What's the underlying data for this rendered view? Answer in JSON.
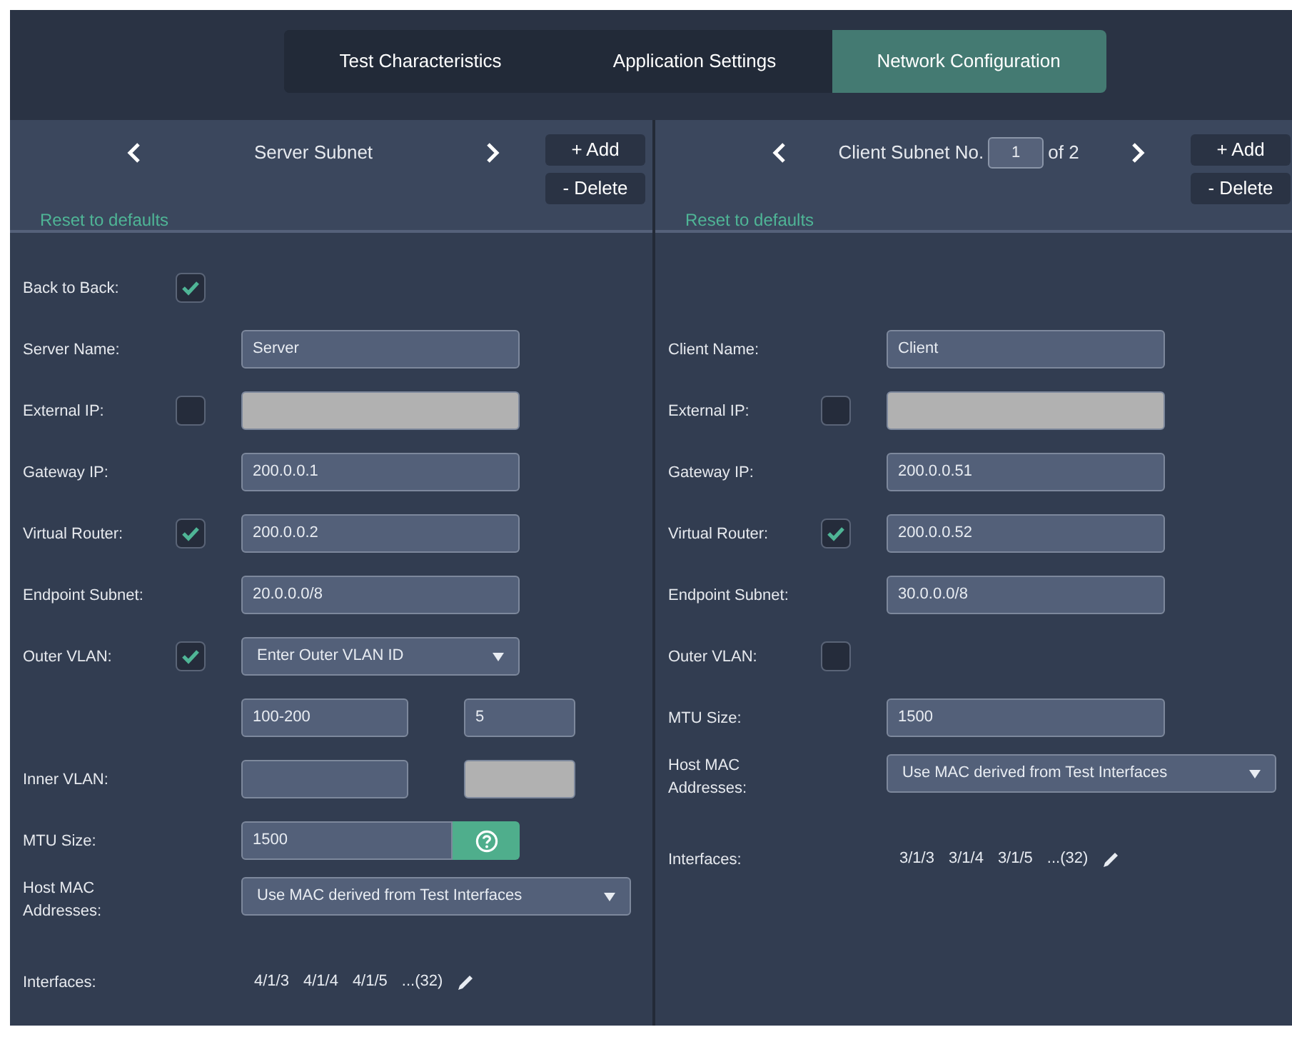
{
  "tabs": [
    {
      "label": "Test Characteristics",
      "selected": false
    },
    {
      "label": "Application Settings",
      "selected": false
    },
    {
      "label": "Network Configuration",
      "selected": true
    }
  ],
  "panels": [
    {
      "header": {
        "kind": "title",
        "title": "Server Subnet",
        "add": "+ Add",
        "delete": "- Delete",
        "reset": "Reset to defaults"
      },
      "rows": [
        {
          "kind": "check",
          "label": "Back to Back:",
          "checked": true
        },
        {
          "kind": "input",
          "label": "Server Name:",
          "value": "Server",
          "disabled": false
        },
        {
          "kind": "input",
          "label": "External IP:",
          "checked": false,
          "disabled": true
        },
        {
          "kind": "input",
          "label": "Gateway IP:",
          "value": "200.0.0.1",
          "disabled": false
        },
        {
          "kind": "input",
          "label": "Virtual Router:",
          "checked": true,
          "value": "200.0.0.2",
          "disabled": false
        },
        {
          "kind": "input",
          "label": "Endpoint Subnet:",
          "value": "20.0.0.0/8",
          "disabled": false
        },
        {
          "kind": "select",
          "label": "Outer VLAN:",
          "checked": true,
          "value": "Enter Outer VLAN ID"
        },
        {
          "kind": "pair",
          "fields": [
            {
              "value": "100-200",
              "disabled": false
            },
            {
              "value": "5",
              "disabled": false
            }
          ]
        },
        {
          "kind": "pair",
          "label": "Inner VLAN:",
          "fields": [
            {
              "disabled": false
            },
            {
              "disabled": true
            }
          ]
        },
        {
          "kind": "help_input",
          "label": "MTU Size:",
          "value": "1500"
        },
        {
          "kind": "wide_select",
          "label": "Host MAC Addresses:",
          "value": "Use MAC derived from Test Interfaces"
        },
        {
          "kind": "interfaces",
          "label": "Interfaces:",
          "items": [
            "4/1/3",
            "4/1/4",
            "4/1/5",
            "...(32)"
          ]
        }
      ]
    },
    {
      "header": {
        "kind": "counter",
        "title": "Client Subnet No.",
        "number": "1",
        "of": "of 2",
        "add": "+ Add",
        "delete": "- Delete",
        "reset": "Reset to defaults"
      },
      "rows": [
        {
          "kind": "input",
          "label": "Client Name:",
          "value": "Client",
          "disabled": false
        },
        {
          "kind": "input",
          "label": "External IP:",
          "checked": false,
          "disabled": true
        },
        {
          "kind": "input",
          "label": "Gateway IP:",
          "value": "200.0.0.51",
          "disabled": false
        },
        {
          "kind": "input",
          "label": "Virtual Router:",
          "checked": true,
          "value": "200.0.0.52",
          "disabled": false
        },
        {
          "kind": "input",
          "label": "Endpoint Subnet:",
          "value": "30.0.0.0/8",
          "disabled": false
        },
        {
          "kind": "check",
          "label": "Outer VLAN:",
          "checked": false
        },
        {
          "kind": "input",
          "label": "MTU Size:",
          "value": "1500",
          "disabled": false
        },
        {
          "kind": "wide_select",
          "label": "Host MAC Addresses:",
          "value": "Use MAC derived from Test Interfaces"
        },
        {
          "kind": "interfaces",
          "label": "Interfaces:",
          "items": [
            "3/1/3",
            "3/1/4",
            "3/1/5",
            "...(32)"
          ]
        }
      ]
    }
  ]
}
